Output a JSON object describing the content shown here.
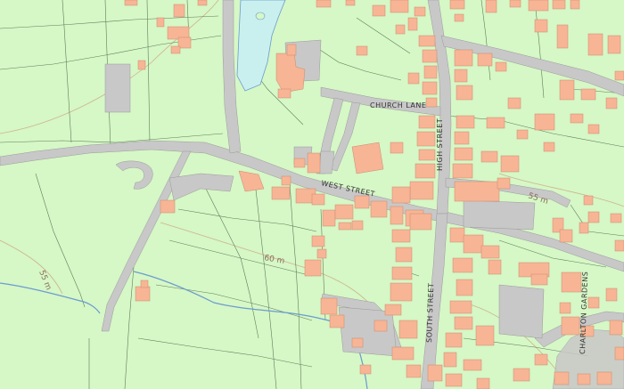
{
  "map": {
    "labels": {
      "church_lane": "CHURCH LANE",
      "high_street": "HIGH STREET",
      "west_street": "WEST STREET",
      "south_street": "SOUTH STREET",
      "charlton_gardens": "CHARLTON GARDENS"
    },
    "contours": {
      "c60": "60 m",
      "c55a": "55 m",
      "c55b": "55 m"
    },
    "colors": {
      "land": "#d6f7c6",
      "road": "#c8c8c8",
      "building": "#f7b595",
      "water": "#c9f0ee",
      "stream": "#6a9ccf",
      "boundary": "#5f7d5a",
      "contour": "#c9a47e"
    }
  }
}
